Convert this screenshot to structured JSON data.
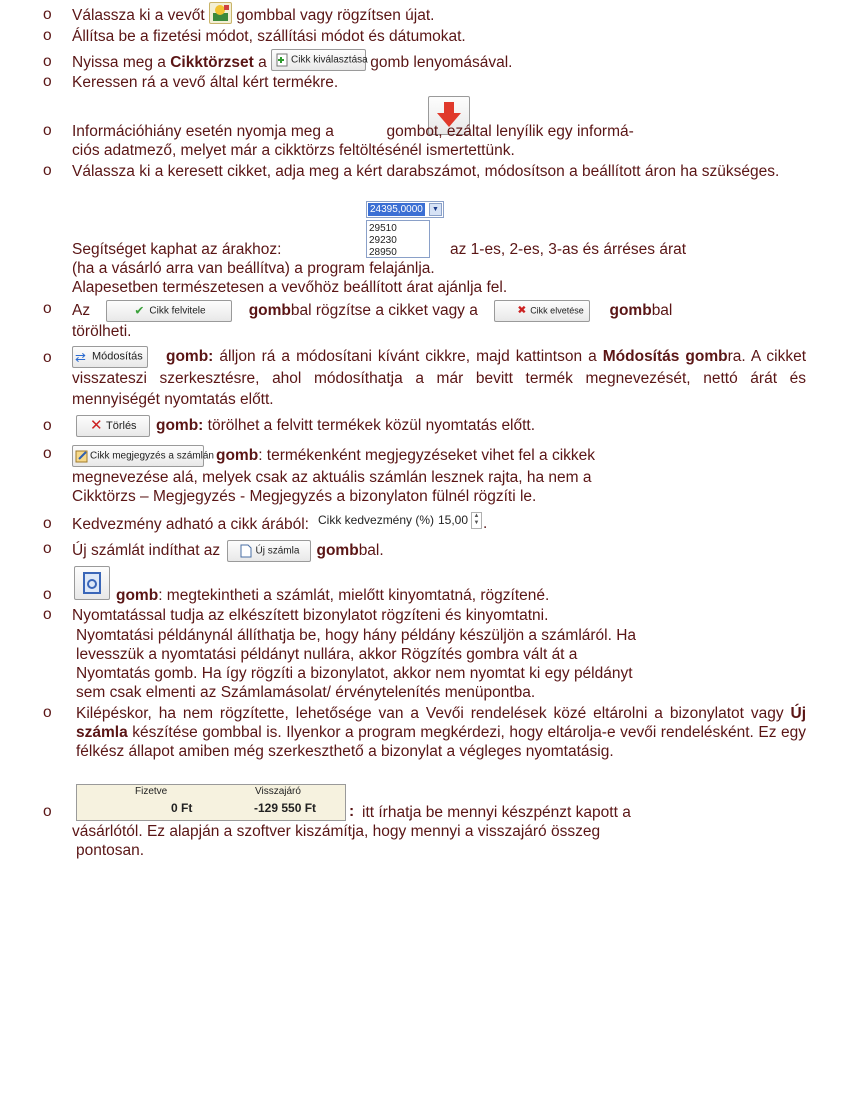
{
  "bullet": "o",
  "i1": {
    "a": "Válassza ki a vevőt ",
    "b": " gombbal vagy rögzítsen újat."
  },
  "i2": "Állítsa be a fizetési módot, szállítási módot és dátumokat.",
  "i3": {
    "a": "Nyissa meg a ",
    "bold": "Cikktörzset",
    "b": " a ",
    "btn": "Cikk kiválasztása",
    "c": " gomb lenyomásával."
  },
  "i4": "Keressen rá a vevő által kért termékre.",
  "i5": {
    "a": "Információhiány esetén nyomja meg a ",
    "b": " gombot, ezáltal lenyílik egy informá-",
    "line2": "ciós adatmező, melyet már a cikktörzs feltöltésénél ismertettünk."
  },
  "i6": "Válassza ki a keresett cikket, adja meg a kért darabszámot, módosítson a beállított áron ha szükséges.",
  "price_dropdown": {
    "selected": "24395,0000",
    "options": [
      "29510",
      "29230",
      "28950"
    ]
  },
  "help": {
    "a": "Segítséget kaphat az árakhoz:",
    "b": "az 1-es, 2-es, 3-as és árréses árat",
    "line2": "(ha a vásárló arra van beállítva) a program felajánlja.",
    "line3": "Alapesetben természetesen a vevőhöz beállított árat ajánlja fel."
  },
  "i7": {
    "a": "Az",
    "btn1": "Cikk felvitele",
    "bold": "gomb",
    "b": "bal rögzítse a cikket vagy a",
    "btn2": "Cikk elvetése",
    "bold2": "gomb",
    "c": "bal",
    "line2": "törölheti."
  },
  "i8": {
    "btn": "Módosítás",
    "bold": "gomb:",
    "a": "álljon rá a módosítani kívánt cikkre, majd kattintson a",
    "bold2": "Módosítás gomb",
    "b": "ra. A cikket visszateszi szerkesztésre, ahol módosíthatja a már bevitt termék megnevezését, nettó árát és mennyiségét nyomtatás előtt."
  },
  "i9": {
    "btn": "Törlés",
    "bold": "gomb:",
    "a": "törölhet a felvitt termékek közül nyomtatás előtt."
  },
  "i10": {
    "btn": "Cikk megjegyzés a számlán",
    "bold": "gomb",
    "a": ": termékenként megjegyzéseket vihet fel a cikkek",
    "line2": "megnevezése alá, melyek csak az aktuális számlán lesznek rajta, ha nem a",
    "line3": "Cikktörzs – Megjegyzés - Megjegyzés a bizonylaton fülnél rögzíti le."
  },
  "i11": {
    "a": "Kedvezmény adható a cikk árából:",
    "field_label": "Cikk kedvezmény (%)",
    "field_value": "15,00",
    "b": "."
  },
  "i12": {
    "a": "Új számlát indíthat az",
    "btn": "Új számla",
    "bold": "gomb",
    "b": "bal."
  },
  "i13": {
    "bold": "gomb",
    "a": ": megtekintheti a számlát, mielőtt kinyomtatná, rögzítené."
  },
  "i14": "Nyomtatással tudja az elkészített bizonylatot rögzíteni és kinyomtatni.",
  "para": [
    "Nyomtatási példánynál  állíthatja be, hogy hány példány készüljön a számláról. Ha",
    "levesszük a nyomtatási példányt nullára, akkor Rögzítés gombra vált át a",
    "Nyomtatás gomb. Ha így rögzíti a bizonylatot, akkor nem nyomtat ki egy példányt",
    "sem csak elmenti az Számlamásolat/ érvénytelenítés menüpontba."
  ],
  "i15": {
    "a": "Kilépéskor, ha nem rögzítette, lehetősége van a Vevői rendelések közé eltárolni a bizonylatot vagy ",
    "bold": "Új számla",
    "b": " készítése gombbal is. Ilyenkor a program megkérdezi, hogy eltárolja-e vevői rendelésként. Ez egy félkész állapot amiben még szerkeszthető a bizonylat a végleges nyomtatásig."
  },
  "i16": {
    "fizetve_label": "Fizetve",
    "fizetve_value": "0 Ft",
    "vissza_label": "Visszajáró",
    "vissza_value": "-129 550 Ft",
    "colon": ":",
    "a": "itt írhatja be mennyi készpénzt kapott a",
    "line2": "vásárlótól. Ez alapján a szoftver kiszámítja, hogy mennyi a visszajáró összeg",
    "line3": "pontosan."
  },
  "colors": {
    "text": "#5a1515",
    "check_green": "#3aa13a",
    "cross_red": "#cc2222",
    "arrow_red": "#e03a2c"
  }
}
